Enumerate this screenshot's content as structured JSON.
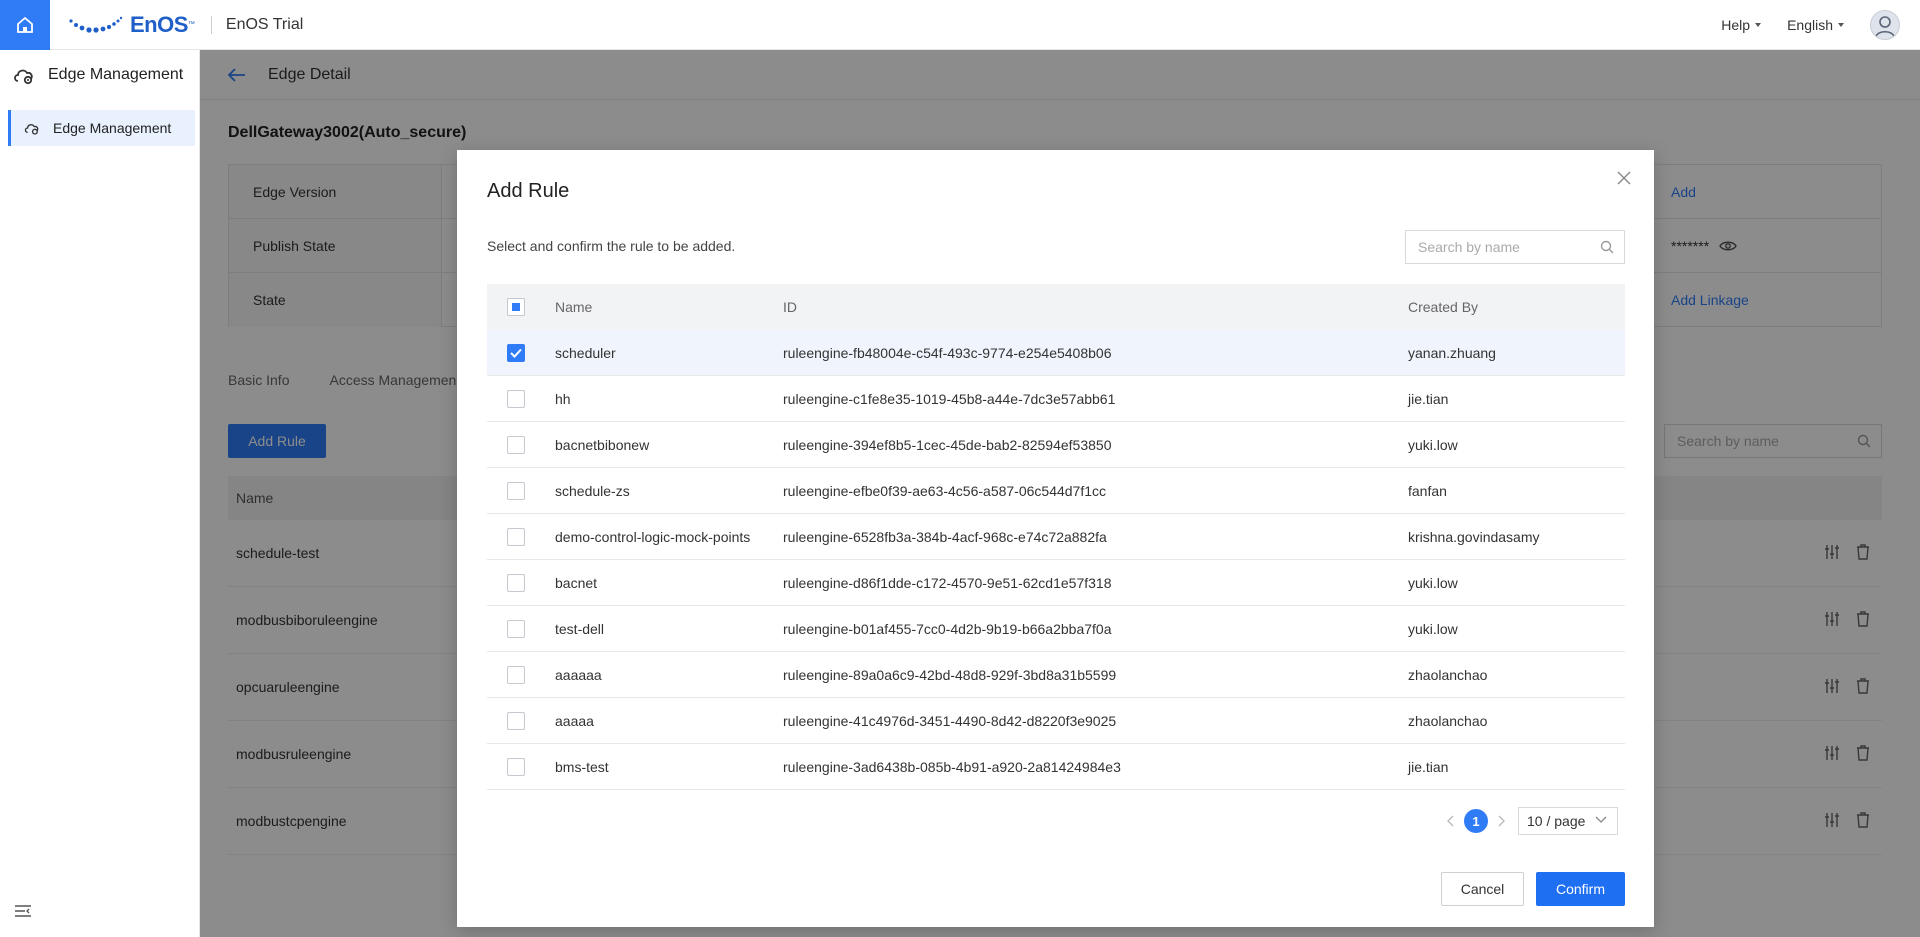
{
  "topbar": {
    "logo_text": "EnOS",
    "logo_tm": "™",
    "brand_name": "EnOS Trial",
    "help_label": "Help",
    "language_label": "English"
  },
  "sidebar": {
    "title": "Edge Management",
    "items": [
      {
        "label": "Edge Management",
        "active": true
      }
    ]
  },
  "page": {
    "header_title": "Edge Detail",
    "device_title": "DellGateway3002(Auto_secure)",
    "info_rows": [
      {
        "label": "Edge Version",
        "right_link": "Add"
      },
      {
        "label": "Publish State",
        "right_value": "*******"
      },
      {
        "label": "State",
        "right_link": "Add Linkage"
      }
    ],
    "tabs": [
      "Basic Info",
      "Access Managemen"
    ],
    "add_rule_label": "Add Rule",
    "search_placeholder": "Search by name",
    "table_header_name": "Name",
    "rows": [
      "schedule-test",
      "modbusbiboruleengine",
      "opcuaruleengine",
      "modbusruleengine",
      "modbustcpengine"
    ]
  },
  "modal": {
    "title": "Add Rule",
    "description": "Select and confirm the rule to be added.",
    "search_placeholder": "Search by name",
    "columns": {
      "name": "Name",
      "id": "ID",
      "created_by": "Created By"
    },
    "rules": [
      {
        "name": "scheduler",
        "id": "ruleengine-fb48004e-c54f-493c-9774-e254e5408b06",
        "created_by": "yanan.zhuang",
        "checked": true
      },
      {
        "name": "hh",
        "id": "ruleengine-c1fe8e35-1019-45b8-a44e-7dc3e57abb61",
        "created_by": "jie.tian",
        "checked": false
      },
      {
        "name": "bacnetbibonew",
        "id": "ruleengine-394ef8b5-1cec-45de-bab2-82594ef53850",
        "created_by": "yuki.low",
        "checked": false
      },
      {
        "name": "schedule-zs",
        "id": "ruleengine-efbe0f39-ae63-4c56-a587-06c544d7f1cc",
        "created_by": "fanfan",
        "checked": false
      },
      {
        "name": "demo-control-logic-mock-points",
        "id": "ruleengine-6528fb3a-384b-4acf-968c-e74c72a882fa",
        "created_by": "krishna.govindasamy",
        "checked": false
      },
      {
        "name": "bacnet",
        "id": "ruleengine-d86f1dde-c172-4570-9e51-62cd1e57f318",
        "created_by": "yuki.low",
        "checked": false
      },
      {
        "name": "test-dell",
        "id": "ruleengine-b01af455-7cc0-4d2b-9b19-b66a2bba7f0a",
        "created_by": "yuki.low",
        "checked": false
      },
      {
        "name": "aaaaaa",
        "id": "ruleengine-89a0a6c9-42bd-48d8-929f-3bd8a31b5599",
        "created_by": "zhaolanchao",
        "checked": false
      },
      {
        "name": "aaaaa",
        "id": "ruleengine-41c4976d-3451-4490-8d42-d8220f3e9025",
        "created_by": "zhaolanchao",
        "checked": false
      },
      {
        "name": "bms-test",
        "id": "ruleengine-3ad6438b-085b-4b91-a920-2a81424984e3",
        "created_by": "jie.tian",
        "checked": false
      }
    ],
    "pagination": {
      "current_page": "1",
      "page_size": "10 / page"
    },
    "cancel_label": "Cancel",
    "confirm_label": "Confirm"
  },
  "colors": {
    "primary": "#2f7cf6",
    "confirm": "#1f6ff2",
    "overlay": "rgba(0,0,0,0.45)"
  }
}
